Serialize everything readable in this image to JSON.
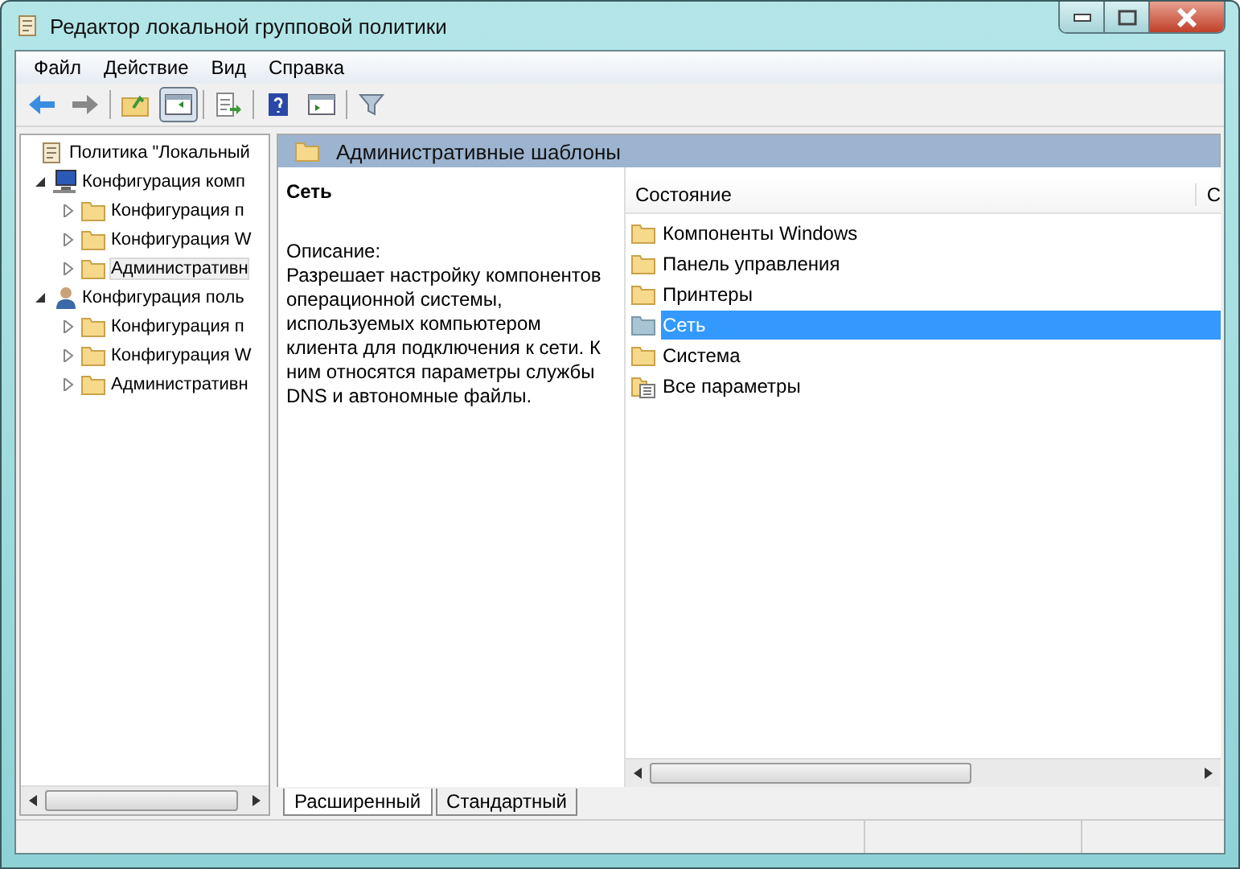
{
  "window": {
    "title": "Редактор локальной групповой политики"
  },
  "menu": [
    "Файл",
    "Действие",
    "Вид",
    "Справка"
  ],
  "tree": [
    {
      "label": "Политика \"Локальный",
      "selected": false,
      "children": [
        {
          "label": "Конфигурация комп",
          "kind": "computer",
          "expanded": true,
          "selected": false,
          "children": [
            {
              "label": "Конфигурация п",
              "kind": "folder",
              "expanded": false,
              "selected": false
            },
            {
              "label": "Конфигурация W",
              "kind": "folder",
              "expanded": false,
              "selected": false
            },
            {
              "label": "Административн",
              "kind": "folder",
              "expanded": false,
              "selected": true
            }
          ]
        },
        {
          "label": "Конфигурация поль",
          "kind": "user",
          "expanded": true,
          "selected": false,
          "children": [
            {
              "label": "Конфигурация п",
              "kind": "folder",
              "expanded": false,
              "selected": false
            },
            {
              "label": "Конфигурация W",
              "kind": "folder",
              "expanded": false,
              "selected": false
            },
            {
              "label": "Административн",
              "kind": "folder",
              "expanded": false,
              "selected": false
            }
          ]
        }
      ]
    }
  ],
  "header": {
    "title": "Административные шаблоны"
  },
  "description": {
    "title": "Сеть",
    "label": "Описание:",
    "text": "Разрешает настройку компонентов операционной системы, используемых компьютером клиента для подключения к сети. К ним относятся параметры службы DNS и автономные файлы."
  },
  "list": {
    "columns": [
      "Состояние",
      "С"
    ],
    "items": [
      {
        "label": "Компоненты Windows",
        "kind": "folder",
        "selected": false
      },
      {
        "label": "Панель управления",
        "kind": "folder",
        "selected": false
      },
      {
        "label": "Принтеры",
        "kind": "folder",
        "selected": false
      },
      {
        "label": "Сеть",
        "kind": "folder",
        "selected": true
      },
      {
        "label": "Система",
        "kind": "folder",
        "selected": false
      },
      {
        "label": "Все параметры",
        "kind": "settings",
        "selected": false
      }
    ]
  },
  "tabs": [
    {
      "label": "Расширенный",
      "selected": true
    },
    {
      "label": "Стандартный",
      "selected": false
    }
  ]
}
